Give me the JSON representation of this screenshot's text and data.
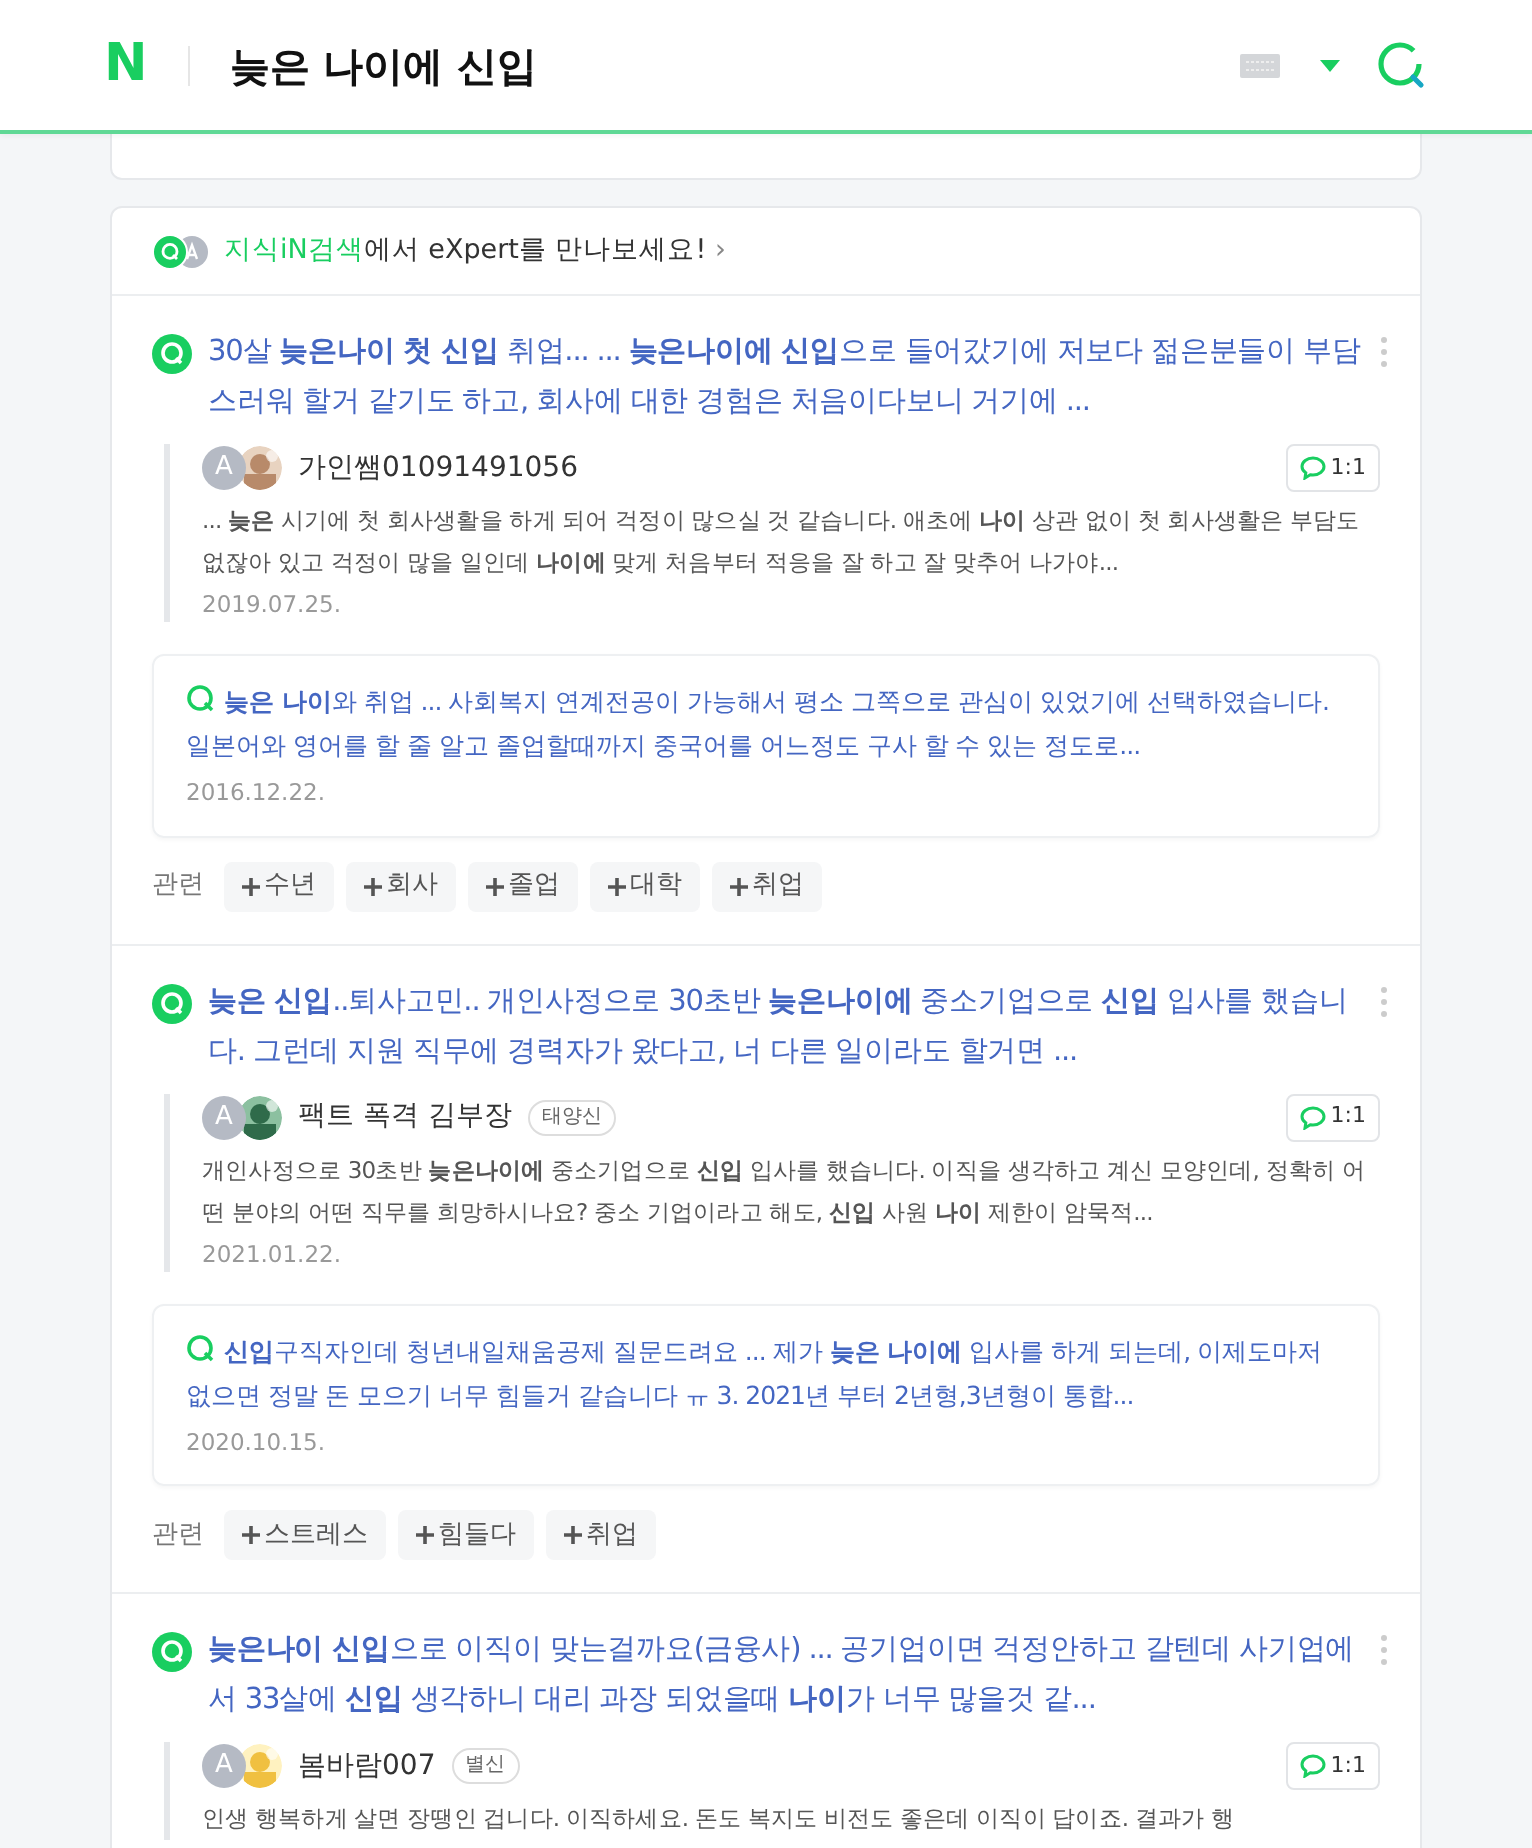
{
  "header": {
    "logo": "N",
    "query": "늦은 나이에 신입"
  },
  "expert_banner": {
    "link": "지식iN검색",
    "text": "에서 eXpert를 만나보세요!",
    "arrow": "›"
  },
  "results": [
    {
      "title": "30살 **늦은나이 첫 신입** 취업... ... **늦은나이에 신입**으로 들어갔기에 저보다 젊은분들이 부담스러워 할거 같기도 하고, 회사에 대한 경험은 처음이다보니 거기에 ...",
      "answer": {
        "avatar": "A",
        "name": "가인쌤01091491056",
        "chat": "1:1",
        "snippet": "... **늦은** 시기에 첫 회사생활을 하게 되어 걱정이 많으실 것 같습니다. 애초에 **나이** 상관 없이 첫 회사생활은 부담도 없잖아 있고 걱정이 많을 일인데 **나이에** 맞게 처음부터 적응을 잘 하고 잘 맞추어 나가야...",
        "date": "2019.07.25."
      },
      "related_question": {
        "title": "**늦은 나이**와 취업 ... 사회복지 연계전공이 가능해서 평소 그쪽으로 관심이 있었기에 선택하였습니다. 일본어와 영어를 할 줄 알고 졸업할때까지 중국어를 어느정도 구사 할 수 있는 정도로...",
        "date": "2016.12.22."
      },
      "related": {
        "label": "관련",
        "tags": [
          "수년",
          "회사",
          "졸업",
          "대학",
          "취업"
        ]
      }
    },
    {
      "title": "**늦은 신입**..퇴사고민.. 개인사정으로 30초반 **늦은나이에** 중소기업으로 **신입** 입사를 했습니다. 그런데 지원 직무에 경력자가 왔다고, 너 다른 일이라도 할거면 ...",
      "answer": {
        "avatar": "A",
        "name": "팩트 폭격 김부장",
        "badge": "태양신",
        "chat": "1:1",
        "snippet": "개인사정으로 30초반 **늦은나이에** 중소기업으로 **신입** 입사를 했습니다. 이직을 생각하고 계신 모양인데, 정확히 어떤 분야의 어떤 직무를 희망하시나요? 중소 기업이라고 해도, **신입** 사원 **나이** 제한이 암묵적...",
        "date": "2021.01.22."
      },
      "related_question": {
        "title": "**신입**구직자인데 청년내일채움공제 질문드려요 ... 제가 **늦은 나이에** 입사를 하게 되는데, 이제도마저 없으면 정말 돈 모으기 너무 힘들거 같습니다 ㅠ 3. 2021년 부터 2년형,3년형이 통합...",
        "date": "2020.10.15."
      },
      "related": {
        "label": "관련",
        "tags": [
          "스트레스",
          "힘들다",
          "취업"
        ]
      }
    },
    {
      "title": "**늦은나이 신입**으로 이직이 맞는걸까요(금융사) ... 공기업이면 걱정안하고 갈텐데 사기업에서 33살에 **신입** 생각하니 대리 과장 되었을때 **나이**가 너무 많을것 같...",
      "answer": {
        "avatar": "A",
        "name": "봄바람007",
        "badge": "별신",
        "chat": "1:1",
        "snippet": "인생 행복하게 살면 장땡인 겁니다. 이직하세요. 돈도 복지도 비전도 좋은데 이직이 답이죠. 결과가 행"
      }
    }
  ]
}
